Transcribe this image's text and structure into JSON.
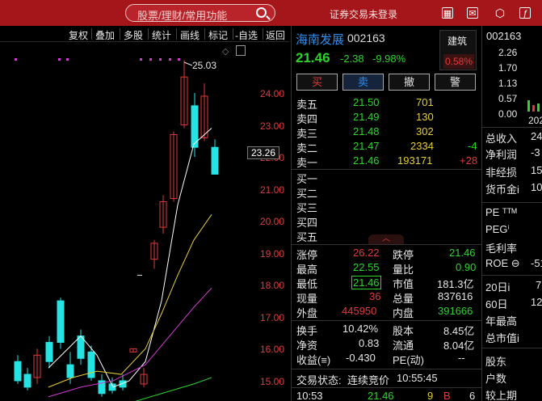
{
  "search": {
    "placeholder": "股票/理财/常用功能"
  },
  "topbar": {
    "login": "证券交易未登录"
  },
  "toolbar": {
    "items": [
      "复权",
      "叠加",
      "多股",
      "统计",
      "画线",
      "标记",
      "-自选",
      "返回"
    ]
  },
  "chart": {
    "high_label": "25.03",
    "current_price": "23.26",
    "y_labels": [
      "24.00",
      "23.00",
      "22.00",
      "21.00",
      "20.00",
      "19.00",
      "18.00",
      "17.00",
      "16.00",
      "15.00"
    ],
    "colors": {
      "up": "#e23a3a",
      "down": "#25e3e3",
      "ma5": "#ffffff",
      "ma10": "#e6cf36",
      "ma20": "#d33ad3"
    }
  },
  "quote": {
    "name": "海南发展",
    "code": "002163",
    "price": "21.46",
    "change": "-2.38",
    "change_pct": "-9.98%",
    "sector": {
      "name": "建筑",
      "pct": "0.58%"
    },
    "buttons": [
      "买",
      "卖",
      "撤",
      "警"
    ],
    "asks": [
      {
        "label": "卖五",
        "price": "21.50",
        "vol": "701",
        "delta": ""
      },
      {
        "label": "卖四",
        "price": "21.49",
        "vol": "130",
        "delta": ""
      },
      {
        "label": "卖三",
        "price": "21.48",
        "vol": "302",
        "delta": ""
      },
      {
        "label": "卖二",
        "price": "21.47",
        "vol": "2334",
        "delta": "-4"
      },
      {
        "label": "卖一",
        "price": "21.46",
        "vol": "193171",
        "delta": "+28"
      }
    ],
    "bids": [
      {
        "label": "买一"
      },
      {
        "label": "买二"
      },
      {
        "label": "买三"
      },
      {
        "label": "买四"
      },
      {
        "label": "买五"
      }
    ],
    "stats": [
      {
        "l1": "涨停",
        "v1": "26.22",
        "c1": "red",
        "l2": "跌停",
        "v2": "21.46",
        "c2": "grn"
      },
      {
        "l1": "最高",
        "v1": "22.55",
        "c1": "grn",
        "l2": "量比",
        "v2": "0.90",
        "c2": "grn"
      },
      {
        "l1": "最低",
        "v1": "21.46",
        "c1": "grn",
        "l2": "市值",
        "v2": "181.3亿",
        "c2": "wht"
      },
      {
        "l1": "现量",
        "v1": "36",
        "c1": "red",
        "l2": "总量",
        "v2": "837616",
        "c2": "wht"
      },
      {
        "l1": "外盘",
        "v1": "445950",
        "c1": "red",
        "l2": "内盘",
        "v2": "391666",
        "c2": "grn"
      }
    ],
    "stats2": [
      {
        "l1": "换手",
        "v1": "10.42%",
        "l2": "股本",
        "v2": "8.45亿"
      },
      {
        "l1": "净资",
        "v1": "0.83",
        "l2": "流通",
        "v2": "8.04亿"
      },
      {
        "l1": "收益(≡)",
        "v1": "-0.430",
        "l2": "PE(动)",
        "v2": "--"
      }
    ],
    "trade_status_label": "交易状态:",
    "trade_status": "连续竞价",
    "trade_time": "10:55:45",
    "tick": {
      "time": "10:53",
      "price": "21.46",
      "vol": "9",
      "side": "B",
      "num": "6"
    }
  },
  "right": {
    "code": "002163",
    "ticks": [
      "2.26",
      "1.70",
      "1.13",
      "0.57",
      "0.00"
    ],
    "year": "202",
    "rows": [
      {
        "label": "总收入",
        "value": "24"
      },
      {
        "label": "净利润",
        "value": "-3"
      },
      {
        "label": "非经损",
        "value": "15"
      },
      {
        "label": "货币金i",
        "value": "10"
      },
      {
        "label": "PE ᵀᵀᴹ",
        "value": ""
      },
      {
        "label": "PEGⁱ",
        "value": ""
      },
      {
        "label": "毛利率",
        "value": ""
      },
      {
        "label": "ROE ⊖",
        "value": "-51"
      },
      {
        "label": "20日i",
        "value": "7"
      },
      {
        "label": "60日",
        "value": "12"
      },
      {
        "label": "年最高",
        "value": ""
      },
      {
        "label": "总市值i",
        "value": ""
      },
      {
        "label": "股东",
        "value": ""
      },
      {
        "label": "户数",
        "value": ""
      },
      {
        "label": "较上期",
        "value": ""
      }
    ]
  }
}
